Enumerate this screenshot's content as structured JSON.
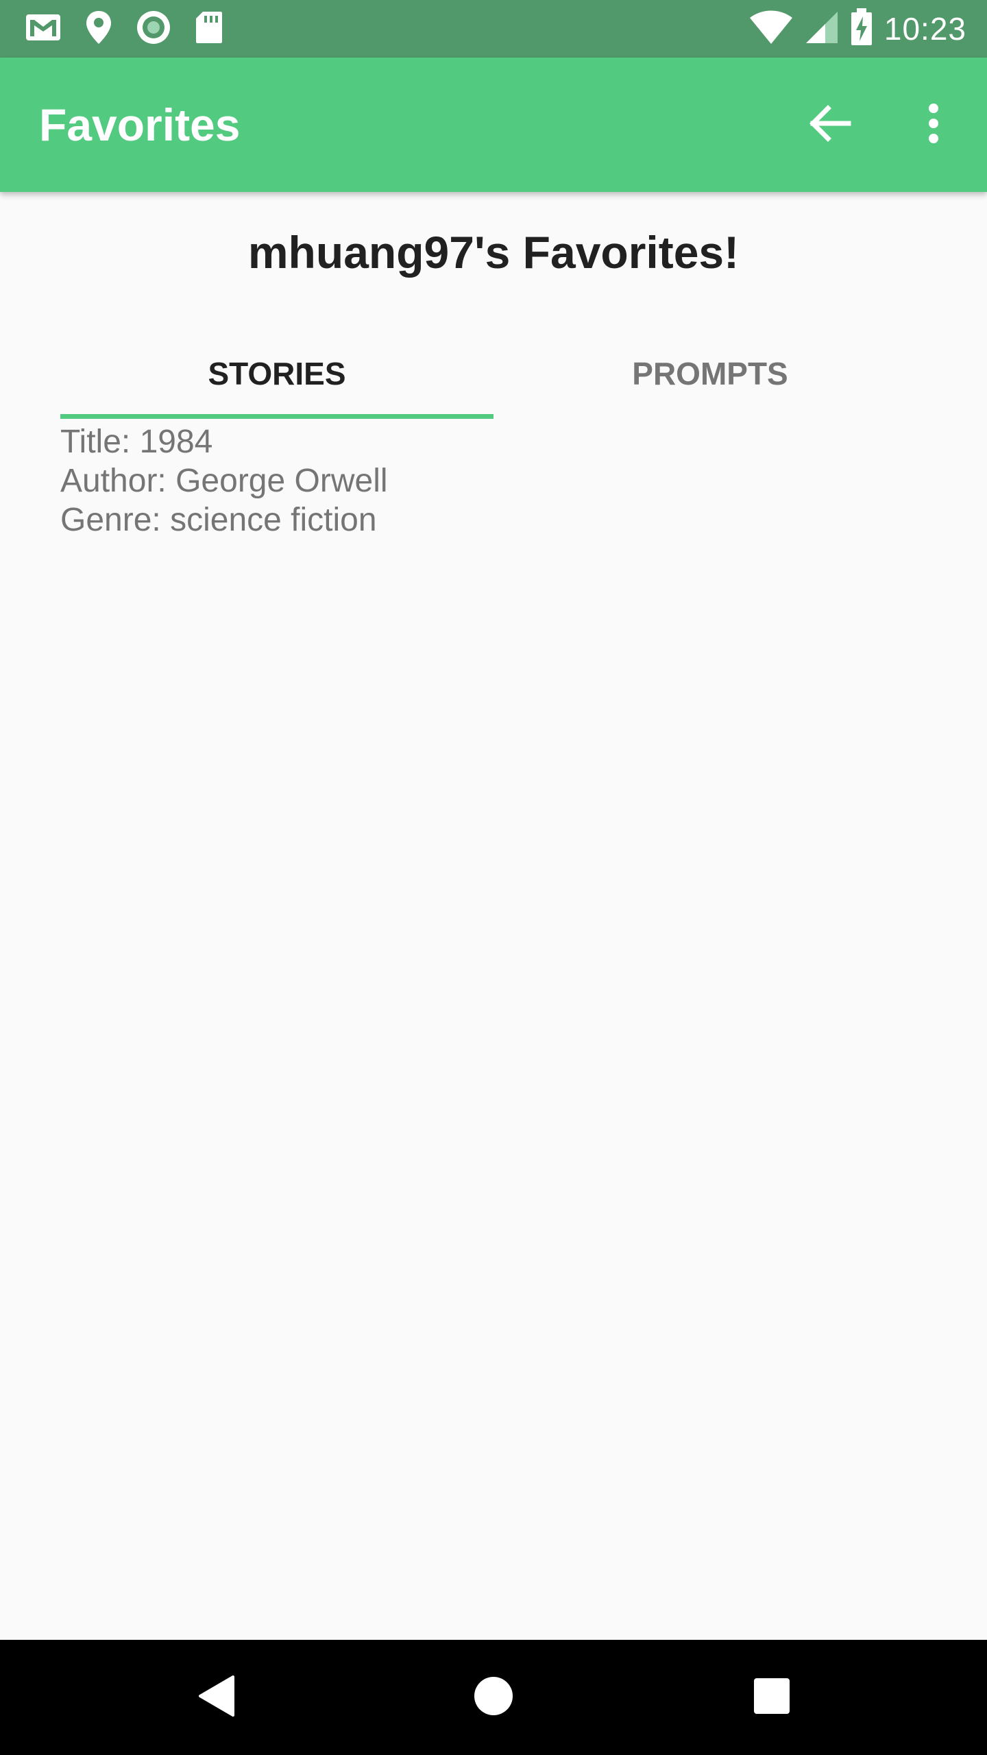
{
  "status_bar": {
    "time": "10:23",
    "left_icons": [
      "gmail-icon",
      "location-pin-icon",
      "record-circle-icon",
      "sd-card-icon"
    ],
    "right_icons": [
      "wifi-icon",
      "cell-signal-icon",
      "battery-charging-icon"
    ],
    "background_color": "#51996a"
  },
  "app_bar": {
    "title": "Favorites",
    "background_color": "#52ca80",
    "actions": [
      "back-arrow-icon",
      "more-vert-icon"
    ]
  },
  "page": {
    "heading": "mhuang97's Favorites!"
  },
  "tabs": [
    {
      "label": "STORIES",
      "selected": true
    },
    {
      "label": "PROMPTS",
      "selected": false
    }
  ],
  "stories": [
    {
      "title": "Title: 1984",
      "author": "Author: George Orwell",
      "genre": "Genre: science fiction"
    }
  ],
  "nav_bar": {
    "buttons": [
      "nav-back-icon",
      "nav-home-icon",
      "nav-recents-icon"
    ]
  }
}
